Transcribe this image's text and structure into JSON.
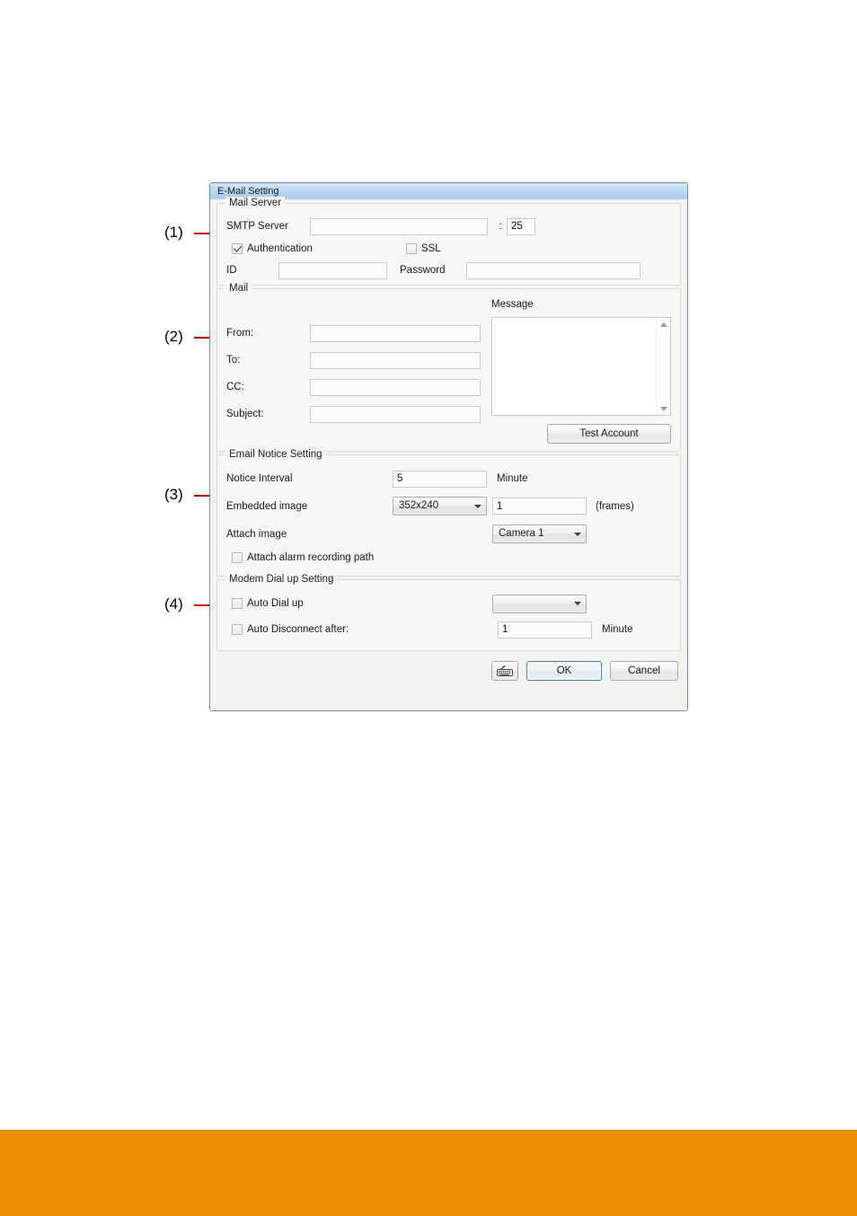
{
  "callouts": [
    {
      "label": "(1)"
    },
    {
      "label": "(2)"
    },
    {
      "label": "(3)"
    },
    {
      "label": "(4)"
    }
  ],
  "dialog": {
    "title": "E-Mail Setting",
    "mail_server": {
      "group_title": "Mail Server",
      "smtp_label": "SMTP Server",
      "smtp_value": "",
      "smtp_placeholder": "",
      "colon": ":",
      "port_value": "25",
      "authentication_label": "Authentication",
      "authentication_checked": true,
      "ssl_label": "SSL",
      "ssl_checked": false,
      "id_label": "ID",
      "id_value": "",
      "password_label": "Password",
      "password_value": ""
    },
    "mail": {
      "group_title": "Mail",
      "message_label": "Message",
      "message_value": "",
      "from_label": "From:",
      "from_value": "",
      "to_label": "To:",
      "to_value": "",
      "cc_label": "CC:",
      "cc_value": "",
      "subject_label": "Subject:",
      "subject_value": "",
      "test_account_label": "Test Account"
    },
    "email_notice": {
      "group_title": "Email Notice Setting",
      "notice_interval_label": "Notice Interval",
      "notice_interval_value": "5",
      "notice_interval_unit": "Minute",
      "embedded_image_label": "Embedded image",
      "embedded_image_value": "352x240",
      "embedded_frames_value": "1",
      "frames_unit": "(frames)",
      "attach_image_label": "Attach image",
      "attach_image_value": "Camera 1",
      "attach_alarm_label": "Attach alarm recording path",
      "attach_alarm_checked": false
    },
    "modem": {
      "group_title": "Modem Dial up Setting",
      "auto_dialup_label": "Auto Dial up",
      "auto_dialup_checked": false,
      "auto_dialup_value": "",
      "auto_disconnect_label": "Auto Disconnect after:",
      "auto_disconnect_checked": false,
      "auto_disconnect_value": "1",
      "auto_disconnect_unit": "Minute"
    },
    "buttons": {
      "keyboard_icon": "keyboard-icon",
      "ok_label": "OK",
      "cancel_label": "Cancel"
    }
  },
  "colors": {
    "footer_band": "#f08c00",
    "callout_line": "#cc0000",
    "titlebar_start": "#cfe3f5",
    "titlebar_end": "#a9cdea",
    "primary_button_border": "#3c7fb1"
  }
}
